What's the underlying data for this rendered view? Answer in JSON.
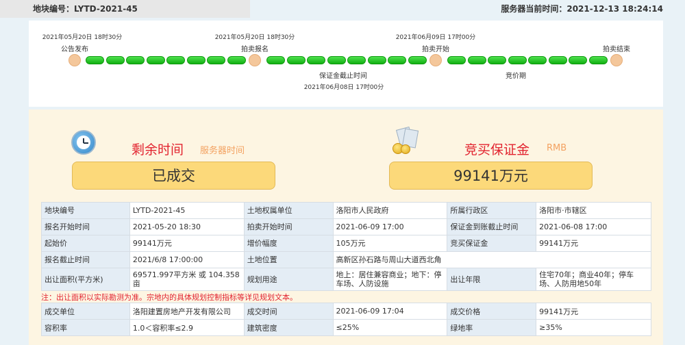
{
  "header": {
    "plot_code": "地块编号：LYTD-2021-45",
    "server_time": "服务器当前时间：2021-12-13 18:24:14"
  },
  "timeline": {
    "stages": [
      {
        "label": "公告发布",
        "time": "2021年05月20日 18时30分"
      },
      {
        "label": "拍卖报名",
        "time": "2021年05月20日 18时30分"
      },
      {
        "label": "拍卖开始",
        "time": "2021年06月09日 17时00分"
      },
      {
        "label": "拍卖结束",
        "time": ""
      }
    ],
    "below": [
      {
        "label": "保证金截止时间",
        "time": "2021年06月08日 17时00分"
      },
      {
        "label": "竞价期",
        "time": ""
      }
    ]
  },
  "remaining": {
    "title": "剩余时间",
    "subtitle": "服务器时间",
    "status": "已成交",
    "icon": "clock-icon"
  },
  "deposit": {
    "title": "竞买保证金",
    "subtitle": "RMB",
    "amount": "99141万元",
    "icon": "money-icon"
  },
  "table": {
    "rows": [
      [
        "地块编号",
        "LYTD-2021-45",
        "土地权属单位",
        "洛阳市人民政府",
        "所属行政区",
        "洛阳市·市辖区"
      ],
      [
        "报名开始时间",
        "2021-05-20 18:30",
        "拍卖开始时间",
        "2021-06-09 17:00",
        "保证金到账截止时间",
        "2021-06-08 17:00"
      ],
      [
        "起始价",
        "99141万元",
        "增价幅度",
        "105万元",
        "竞买保证金",
        "99141万元"
      ],
      [
        "报名截止时间",
        "2021/6/8 17:00:00",
        "土地位置",
        "高新区孙石路与周山大道西北角"
      ],
      [
        "出让面积(平方米)",
        "69571.997平方米 或 104.358亩",
        "规划用途",
        "地上：居住兼容商业；地下：停车场、人防设施",
        "出让年限",
        "住宅70年；商业40年；停车场、人防用地50年"
      ]
    ],
    "note": "注：出让面积以实际勘测为准。宗地内的具体规划控制指标等详见规划文本。",
    "rows2": [
      [
        "成交单位",
        "洛阳建置房地产开发有限公司",
        "成交时间",
        "2021-06-09 17:04",
        "成交价格",
        "99141万元"
      ],
      [
        "容积率",
        "1.0＜容积率≤2.9",
        "建筑密度",
        "≤25%",
        "绿地率",
        "≥35%"
      ]
    ]
  },
  "colors": {
    "accent_red": "#e2232f",
    "progress_green": "#22c022",
    "status_yellow": "#fcd97a"
  }
}
